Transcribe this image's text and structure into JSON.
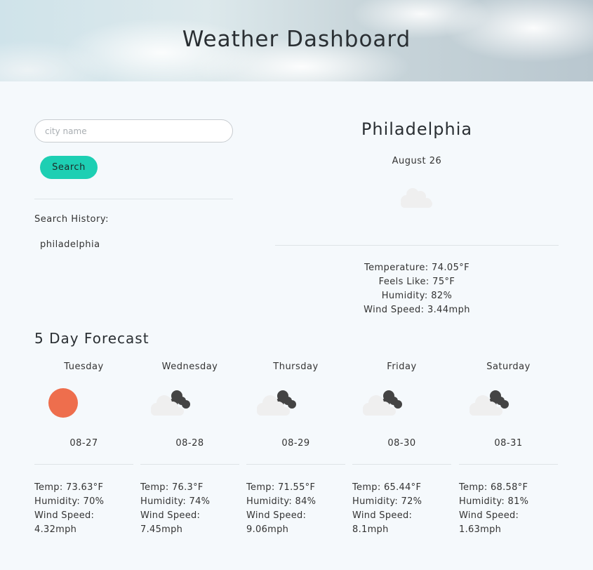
{
  "header": {
    "title": "Weather Dashboard"
  },
  "search": {
    "placeholder": "city name",
    "button_label": "Search"
  },
  "history": {
    "label": "Search History:",
    "items": [
      "philadelphia"
    ]
  },
  "current": {
    "city": "Philadelphia",
    "date": "August 26",
    "icon": "cloud-icon",
    "temperature": "Temperature: 74.05°F",
    "feels_like": "Feels Like: 75°F",
    "humidity": "Humidity: 82%",
    "wind_speed": "Wind Speed: 3.44mph"
  },
  "forecast": {
    "title": "5 Day Forecast",
    "days": [
      {
        "name": "Tuesday",
        "date": "08-27",
        "icon": "sun-icon",
        "temp": "Temp: 73.63°F",
        "humidity": "Humidity: 70%",
        "wind": "Wind Speed: 4.32mph"
      },
      {
        "name": "Wednesday",
        "date": "08-28",
        "icon": "cloudy-icon",
        "temp": "Temp: 76.3°F",
        "humidity": "Humidity: 74%",
        "wind": "Wind Speed: 7.45mph"
      },
      {
        "name": "Thursday",
        "date": "08-29",
        "icon": "cloudy-icon",
        "temp": "Temp: 71.55°F",
        "humidity": "Humidity: 84%",
        "wind": "Wind Speed: 9.06mph"
      },
      {
        "name": "Friday",
        "date": "08-30",
        "icon": "cloudy-icon",
        "temp": "Temp: 65.44°F",
        "humidity": "Humidity: 72%",
        "wind": "Wind Speed: 8.1mph"
      },
      {
        "name": "Saturday",
        "date": "08-31",
        "icon": "cloudy-icon",
        "temp": "Temp: 68.58°F",
        "humidity": "Humidity: 81%",
        "wind": "Wind Speed: 1.63mph"
      }
    ]
  },
  "colors": {
    "accent": "#1dcfb3",
    "sun": "#ee6e4d",
    "cloud_light": "#efefef",
    "cloud_dark": "#444444",
    "background": "#f5f9fc"
  }
}
